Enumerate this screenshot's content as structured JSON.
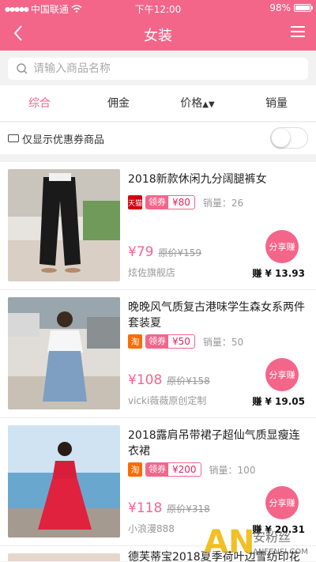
{
  "statusbar": {
    "carrier": "中国联通",
    "time": "下午12:00",
    "battery": "98%",
    "battery_level": 0.98
  },
  "navbar": {
    "title": "女装"
  },
  "search": {
    "placeholder": "请输入商品名称"
  },
  "tabs": [
    {
      "label": "综合",
      "active": true
    },
    {
      "label": "佣金"
    },
    {
      "label": "价格",
      "sort_icon": "sort-arrows-icon"
    },
    {
      "label": "销量"
    }
  ],
  "filter": {
    "label": "仅显示优惠券商品",
    "toggle_on": false
  },
  "products": [
    {
      "title": "2018新款休闲九分阔腿裤女",
      "shop_logo": "天猫",
      "shop_logo_type": "tmall",
      "coupon_tag": "领券",
      "coupon_value": "¥80",
      "sales": "销量：26",
      "price": "¥79",
      "orig_price": "原价¥159",
      "shop": "炫佐旗舰店",
      "share_label": "分享赚",
      "earn": "赚 ¥ 13.93"
    },
    {
      "title": "晚晚风气质复古港味学生森女系两件套装夏",
      "shop_logo": "淘",
      "shop_logo_type": "taobao",
      "coupon_tag": "领券",
      "coupon_value": "¥50",
      "sales": "销量：50",
      "price": "¥108",
      "orig_price": "原价¥158",
      "shop": "vicki薇薇原创定制",
      "share_label": "分享赚",
      "earn": "赚 ¥ 19.05"
    },
    {
      "title": "2018露肩吊带裙子超仙气质显瘦连衣裙",
      "shop_logo": "淘",
      "shop_logo_type": "taobao",
      "coupon_tag": "领券",
      "coupon_value": "¥200",
      "sales": "销量：100",
      "price": "¥118",
      "orig_price": "原价¥318",
      "shop": "小浪漫888",
      "share_label": "分享赚",
      "earn": "赚 ¥ 20.31"
    },
    {
      "title": "德芙蒂宝2018夏季荷叶边雪纺印花"
    }
  ],
  "watermark": {
    "line1": "安粉丝",
    "line2": "ANFENSI.COM"
  },
  "colors": {
    "accent": "#f4658a",
    "tmall": "#d4000f",
    "taobao": "#ff6a00"
  }
}
